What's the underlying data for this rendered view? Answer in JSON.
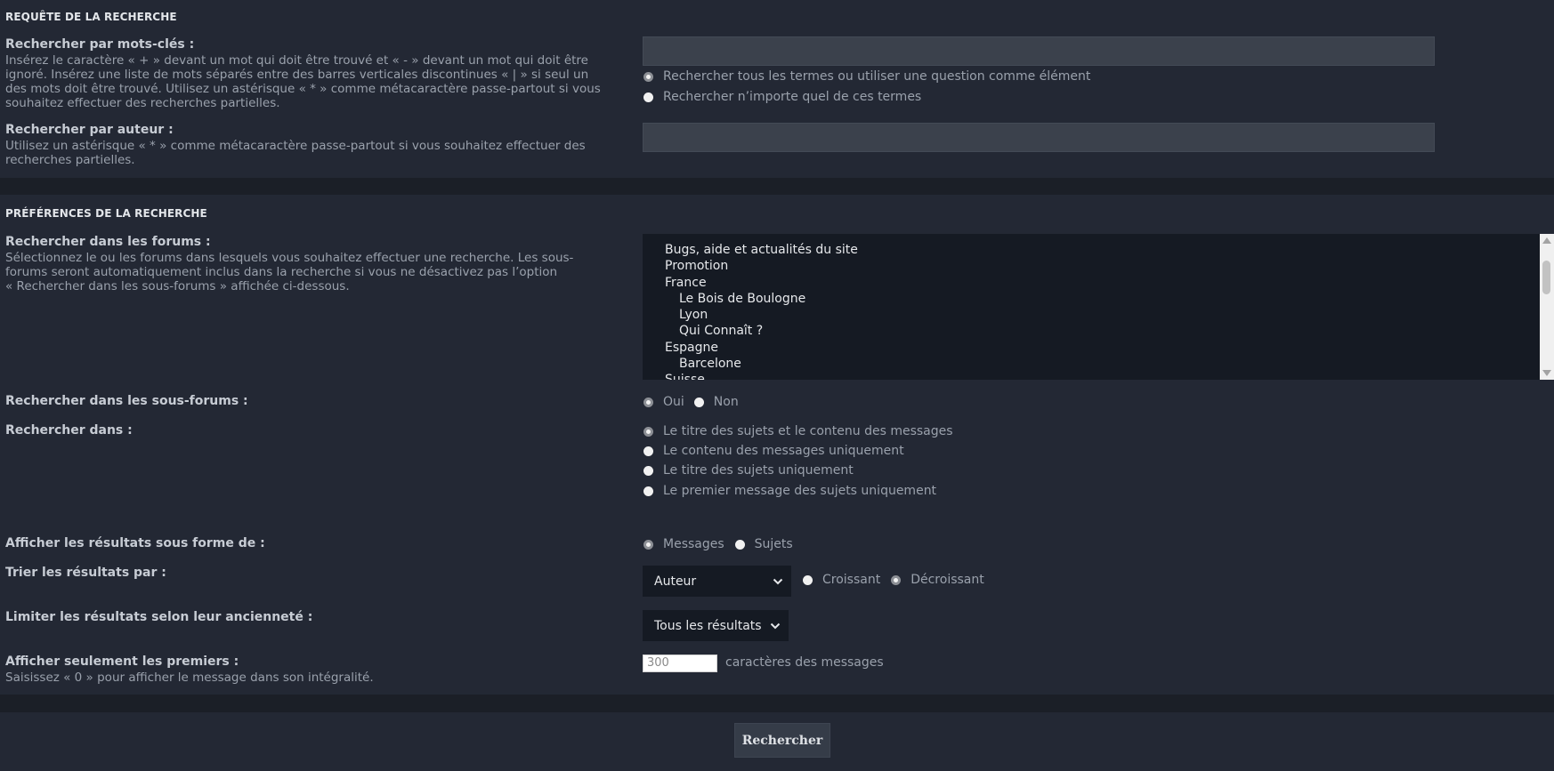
{
  "query": {
    "title": "REQUÊTE DE LA RECHERCHE",
    "keywords": {
      "label": "Rechercher par mots-clés :",
      "explain": [
        "Insérez le caractère « + » devant un mot qui doit être trouvé et « - » devant un mot qui doit être",
        "ignoré. Insérez une liste de mots séparés entre des barres verticales discontinues « | » si seul un",
        "des mots doit être trouvé. Utilisez un astérisque « * » comme métacaractère passe-partout si vous",
        "souhaitez effectuer des recherches partielles."
      ],
      "value": "",
      "options": [
        {
          "label": "Rechercher tous les termes ou utiliser une question comme élément",
          "checked": true
        },
        {
          "label": "Rechercher n’importe quel de ces termes",
          "checked": false
        }
      ]
    },
    "author": {
      "label": "Rechercher par auteur :",
      "explain": [
        "Utilisez un astérisque « * » comme métacaractère passe-partout si vous souhaitez effectuer des",
        "recherches partielles."
      ],
      "value": ""
    }
  },
  "prefs": {
    "title": "PRÉFÉRENCES DE LA RECHERCHE",
    "forums": {
      "label": "Rechercher dans les forums :",
      "explain": [
        "Sélectionnez le ou les forums dans lesquels vous souhaitez effectuer une recherche. Les sous-",
        "forums seront automatiquement inclus dans la recherche si vous ne désactivez pas l’option",
        "« Rechercher dans les sous-forums » affichée ci-dessous."
      ],
      "items": [
        {
          "label": "Bugs, aide et actualités du site",
          "indent": 1
        },
        {
          "label": "Promotion",
          "indent": 1
        },
        {
          "label": "France",
          "indent": 1
        },
        {
          "label": "Le Bois de Boulogne",
          "indent": 2
        },
        {
          "label": "Lyon",
          "indent": 2
        },
        {
          "label": "Qui Connaît ?",
          "indent": 2
        },
        {
          "label": "Espagne",
          "indent": 1
        },
        {
          "label": "Barcelone",
          "indent": 2
        },
        {
          "label": "Suisse",
          "indent": 1
        }
      ]
    },
    "subforums": {
      "label": "Rechercher dans les sous-forums :",
      "options": [
        {
          "label": "Oui",
          "checked": true
        },
        {
          "label": "Non",
          "checked": false
        }
      ]
    },
    "searchin": {
      "label": "Rechercher dans :",
      "options": [
        {
          "label": "Le titre des sujets et le contenu des messages",
          "checked": true
        },
        {
          "label": "Le contenu des messages uniquement",
          "checked": false
        },
        {
          "label": "Le titre des sujets uniquement",
          "checked": false
        },
        {
          "label": "Le premier message des sujets uniquement",
          "checked": false
        }
      ]
    },
    "display": {
      "label": "Afficher les résultats sous forme de :",
      "options": [
        {
          "label": "Messages",
          "checked": true
        },
        {
          "label": "Sujets",
          "checked": false
        }
      ]
    },
    "sort": {
      "label": "Trier les résultats par :",
      "selected": "Auteur",
      "options": [
        {
          "label": "Croissant",
          "checked": false
        },
        {
          "label": "Décroissant",
          "checked": true
        }
      ]
    },
    "age": {
      "label": "Limiter les résultats selon leur ancienneté :",
      "selected": "Tous les résultats"
    },
    "chars": {
      "label": "Afficher seulement les premiers :",
      "explain": "Saisissez « 0 » pour afficher le message dans son intégralité.",
      "value": "300",
      "suffix": "caractères des messages"
    }
  },
  "submit": {
    "label": "Rechercher"
  }
}
